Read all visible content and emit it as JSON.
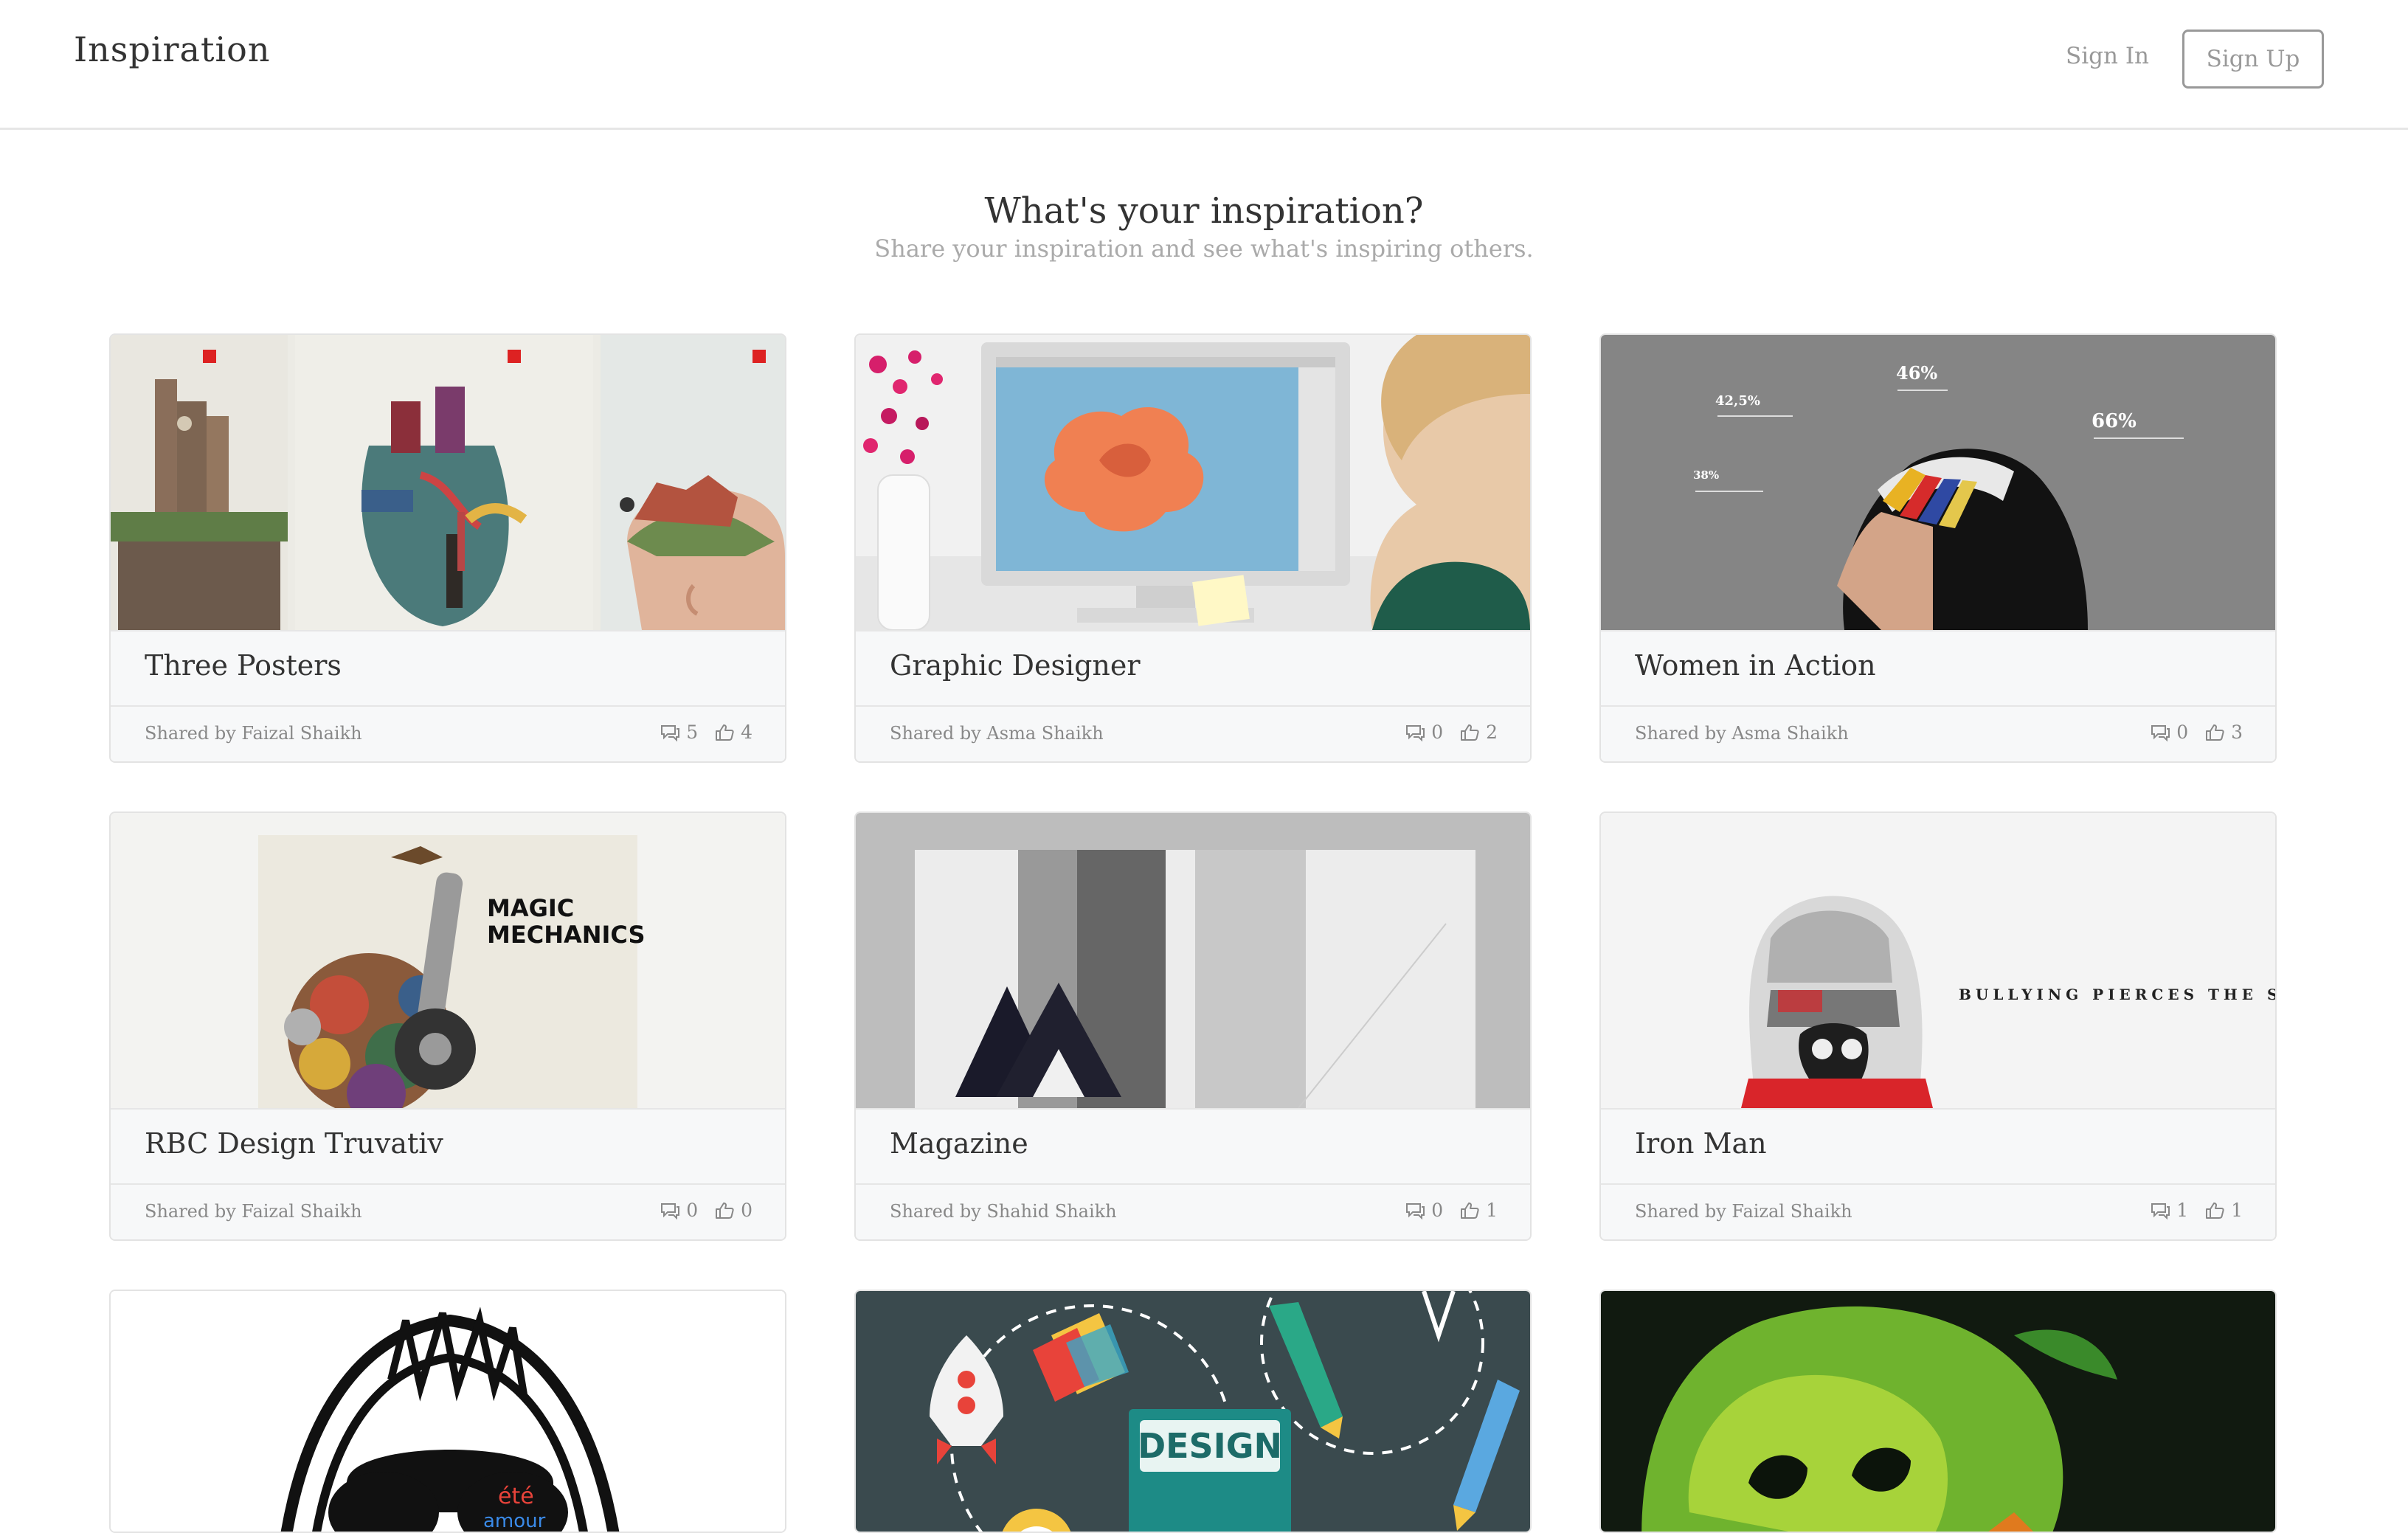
{
  "navbar": {
    "brand": "Inspiration",
    "sign_in": "Sign In",
    "sign_up": "Sign Up"
  },
  "hero": {
    "title": "What's your inspiration?",
    "subtitle": "Share your inspiration and see what's inspiring others."
  },
  "cards": [
    {
      "title": "Three Posters",
      "shared_by": "Shared by Faizal Shaikh",
      "comments": "5",
      "likes": "4"
    },
    {
      "title": "Graphic Designer",
      "shared_by": "Shared by Asma Shaikh",
      "comments": "0",
      "likes": "2"
    },
    {
      "title": "Women in Action",
      "shared_by": "Shared by Asma Shaikh",
      "comments": "0",
      "likes": "3"
    },
    {
      "title": "RBC Design Truvativ",
      "shared_by": "Shared by Faizal Shaikh",
      "comments": "0",
      "likes": "0"
    },
    {
      "title": "Magazine",
      "shared_by": "Shared by Shahid Shaikh",
      "comments": "0",
      "likes": "1"
    },
    {
      "title": "Iron Man",
      "shared_by": "Shared by Faizal Shaikh",
      "comments": "1",
      "likes": "1"
    }
  ],
  "image_text": {
    "women_pct_1": "46%",
    "women_pct_2": "42,5%",
    "women_pct_3": "66%",
    "women_pct_4": "38%",
    "magic_1": "MAGIC",
    "magic_2": "MECHANICS",
    "bullying": "BULLYING PIERCES THE SOU",
    "design": "DESIGN",
    "ete": "été",
    "amour": "amour"
  },
  "icons": {
    "comment": "comments-icon",
    "like": "thumbs-up-icon"
  }
}
